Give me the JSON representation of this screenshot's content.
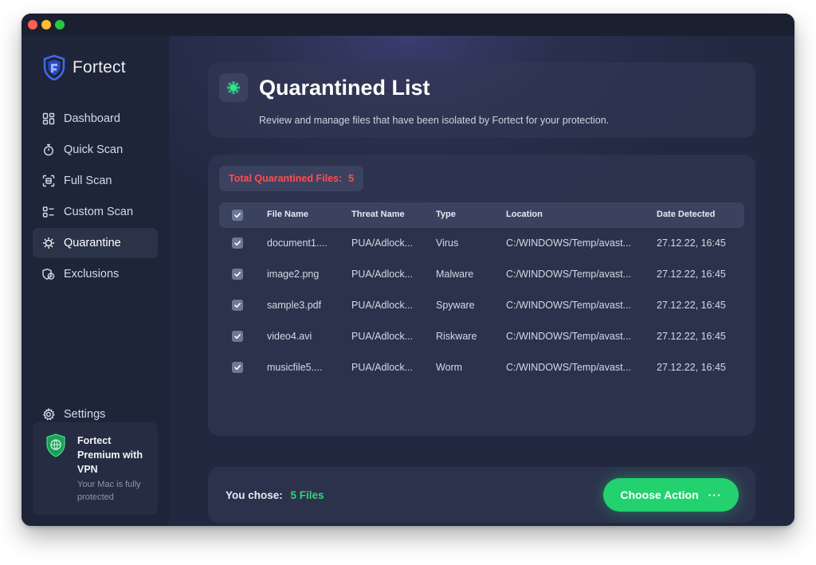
{
  "app": {
    "name": "Fortect"
  },
  "sidebar": {
    "items": [
      {
        "label": "Dashboard",
        "icon": "dashboard-icon",
        "active": false
      },
      {
        "label": "Quick Scan",
        "icon": "stopwatch-icon",
        "active": false
      },
      {
        "label": "Full Scan",
        "icon": "scan-icon",
        "active": false
      },
      {
        "label": "Custom Scan",
        "icon": "custom-scan-icon",
        "active": false
      },
      {
        "label": "Quarantine",
        "icon": "virus-icon",
        "active": true
      },
      {
        "label": "Exclusions",
        "icon": "exclusions-icon",
        "active": false
      }
    ],
    "settings_label": "Settings",
    "premium": {
      "title": "Fortect Premium with VPN",
      "subtitle": "Your Mac is fully protected"
    }
  },
  "header": {
    "title": "Quarantined List",
    "subtitle": "Review and manage files that have been isolated by Fortect for your protection."
  },
  "list": {
    "total_label": "Total Quarantined Files:",
    "total_count": "5",
    "columns": [
      "File Name",
      "Threat Name",
      "Type",
      "Location",
      "Date Detected"
    ],
    "rows": [
      {
        "name": "document1....",
        "threat": "PUA/Adlock...",
        "type": "Virus",
        "location": "C:/WINDOWS/Temp/avast...",
        "date": "27.12.22, 16:45",
        "checked": true
      },
      {
        "name": "image2.png",
        "threat": "PUA/Adlock...",
        "type": "Malware",
        "location": "C:/WINDOWS/Temp/avast...",
        "date": "27.12.22, 16:45",
        "checked": true
      },
      {
        "name": "sample3.pdf",
        "threat": "PUA/Adlock...",
        "type": "Spyware",
        "location": "C:/WINDOWS/Temp/avast...",
        "date": "27.12.22, 16:45",
        "checked": true
      },
      {
        "name": "video4.avi",
        "threat": "PUA/Adlock...",
        "type": "Riskware",
        "location": "C:/WINDOWS/Temp/avast...",
        "date": "27.12.22, 16:45",
        "checked": true
      },
      {
        "name": "musicfile5....",
        "threat": "PUA/Adlock...",
        "type": "Worm",
        "location": "C:/WINDOWS/Temp/avast...",
        "date": "27.12.22, 16:45",
        "checked": true
      }
    ]
  },
  "footer": {
    "chose_label": "You chose:",
    "chose_value": "5 Files",
    "action_label": "Choose Action",
    "action_more": "···"
  },
  "colors": {
    "accent_green": "#23d16f",
    "alert_red": "#ff4d4f",
    "background": "#1e2436"
  }
}
